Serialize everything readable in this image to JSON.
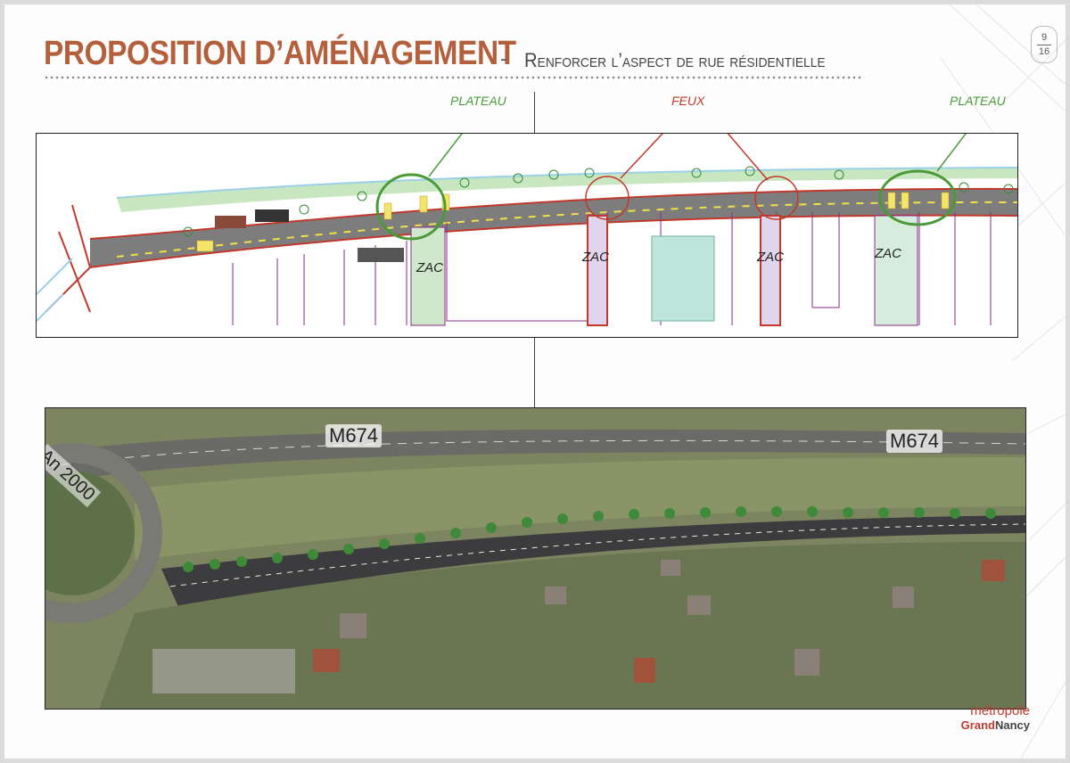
{
  "header": {
    "title": "PROPOSITION D’AMÉNAGEMENT",
    "separator": "-",
    "subtitle": "Renforcer l’aspect de rue résidentielle"
  },
  "page": {
    "current": "9",
    "total": "16"
  },
  "plan": {
    "callouts": {
      "plateau_left": "PLATEAU",
      "feux": "FEUX",
      "plateau_right": "PLATEAU"
    },
    "zac_labels": [
      "ZAC",
      "ZAC",
      "ZAC",
      "ZAC"
    ]
  },
  "aerial": {
    "road_label_1": "M674",
    "road_label_2": "M674",
    "roundabout_label": "An 2000"
  },
  "logo": {
    "line1": "métropole",
    "line2_a": "Grand",
    "line2_b": "Nancy"
  },
  "colors": {
    "title": "#b5603d",
    "accent_red": "#c0392b",
    "accent_green": "#4a9a3a"
  }
}
